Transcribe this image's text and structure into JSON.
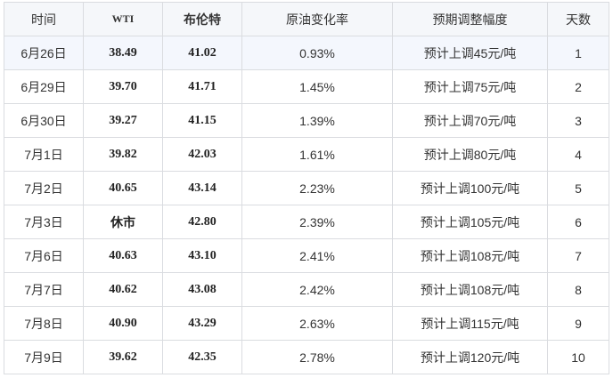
{
  "headers": {
    "date": "时间",
    "wti": "WTI",
    "brent": "布伦特",
    "change": "原油变化率",
    "adjust": "预期调整幅度",
    "days": "天数"
  },
  "rows": [
    {
      "date": "6月26日",
      "wti": "38.49",
      "brent": "41.02",
      "change": "0.93%",
      "adjust": "预计上调45元/吨",
      "days": "1"
    },
    {
      "date": "6月29日",
      "wti": "39.70",
      "brent": "41.71",
      "change": "1.45%",
      "adjust": "预计上调75元/吨",
      "days": "2"
    },
    {
      "date": "6月30日",
      "wti": "39.27",
      "brent": "41.15",
      "change": "1.39%",
      "adjust": "预计上调70元/吨",
      "days": "3"
    },
    {
      "date": "7月1日",
      "wti": "39.82",
      "brent": "42.03",
      "change": "1.61%",
      "adjust": "预计上调80元/吨",
      "days": "4"
    },
    {
      "date": "7月2日",
      "wti": "40.65",
      "brent": "43.14",
      "change": "2.23%",
      "adjust": "预计上调100元/吨",
      "days": "5"
    },
    {
      "date": "7月3日",
      "wti": "休市",
      "brent": "42.80",
      "change": "2.39%",
      "adjust": "预计上调105元/吨",
      "days": "6"
    },
    {
      "date": "7月6日",
      "wti": "40.63",
      "brent": "43.10",
      "change": "2.41%",
      "adjust": "预计上调108元/吨",
      "days": "7"
    },
    {
      "date": "7月7日",
      "wti": "40.62",
      "brent": "43.08",
      "change": "2.42%",
      "adjust": "预计上调108元/吨",
      "days": "8"
    },
    {
      "date": "7月8日",
      "wti": "40.90",
      "brent": "43.29",
      "change": "2.63%",
      "adjust": "预计上调115元/吨",
      "days": "9"
    },
    {
      "date": "7月9日",
      "wti": "39.62",
      "brent": "42.35",
      "change": "2.78%",
      "adjust": "预计上调120元/吨",
      "days": "10"
    }
  ],
  "colors": {
    "border": "#dadce0",
    "header_bg": "#f5f7fa",
    "first_row_bg": "#f4f7fd"
  }
}
